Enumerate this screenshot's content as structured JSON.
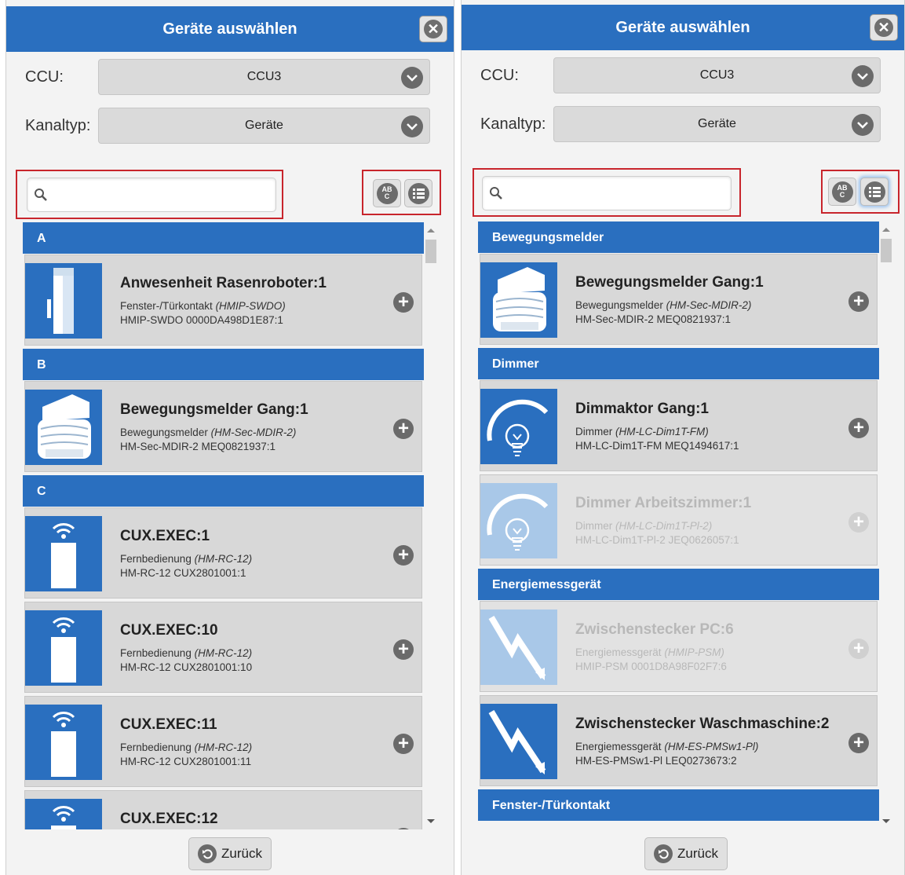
{
  "left": {
    "title": "Geräte auswählen",
    "ccu_label": "CCU:",
    "ccu_value": "CCU3",
    "kanaltyp_label": "Kanaltyp:",
    "kanaltyp_value": "Geräte",
    "search_placeholder": "",
    "sections": [
      {
        "header": "A",
        "items": [
          {
            "title": "Anwesenheit Rasenroboter:1",
            "type": "Fenster-/Türkontakt",
            "model": "(HMIP-SWDO)",
            "address": "HMIP-SWDO 0000DA498D1E87:1",
            "icon": "door-contact-icon"
          }
        ]
      },
      {
        "header": "B",
        "items": [
          {
            "title": "Bewegungsmelder Gang:1",
            "type": "Bewegungsmelder",
            "model": "(HM-Sec-MDIR-2)",
            "address": "HM-Sec-MDIR-2 MEQ0821937:1",
            "icon": "motion-sensor-icon"
          }
        ]
      },
      {
        "header": "C",
        "items": [
          {
            "title": "CUX.EXEC:1",
            "type": "Fernbedienung",
            "model": "(HM-RC-12)",
            "address": "HM-RC-12 CUX2801001:1",
            "icon": "remote-control-icon"
          },
          {
            "title": "CUX.EXEC:10",
            "type": "Fernbedienung",
            "model": "(HM-RC-12)",
            "address": "HM-RC-12 CUX2801001:10",
            "icon": "remote-control-icon"
          },
          {
            "title": "CUX.EXEC:11",
            "type": "Fernbedienung",
            "model": "(HM-RC-12)",
            "address": "HM-RC-12 CUX2801001:11",
            "icon": "remote-control-icon"
          },
          {
            "title": "CUX.EXEC:12",
            "type": "",
            "model": "",
            "address": "",
            "icon": "remote-control-icon"
          }
        ]
      }
    ],
    "back_label": "Zurück"
  },
  "right": {
    "title": "Geräte auswählen",
    "ccu_label": "CCU:",
    "ccu_value": "CCU3",
    "kanaltyp_label": "Kanaltyp:",
    "kanaltyp_value": "Geräte",
    "search_placeholder": "",
    "sections": [
      {
        "header": "Bewegungsmelder",
        "items": [
          {
            "title": "Bewegungsmelder Gang:1",
            "type": "Bewegungsmelder",
            "model": "(HM-Sec-MDIR-2)",
            "address": "HM-Sec-MDIR-2 MEQ0821937:1",
            "icon": "motion-sensor-icon",
            "disabled": false
          }
        ]
      },
      {
        "header": "Dimmer",
        "items": [
          {
            "title": "Dimmaktor Gang:1",
            "type": "Dimmer",
            "model": "(HM-LC-Dim1T-FM)",
            "address": "HM-LC-Dim1T-FM MEQ1494617:1",
            "icon": "dimmer-bulb-icon",
            "disabled": false
          },
          {
            "title": "Dimmer Arbeitszimmer:1",
            "type": "Dimmer",
            "model": "(HM-LC-Dim1T-Pl-2)",
            "address": "HM-LC-Dim1T-Pl-2 JEQ0626057:1",
            "icon": "dimmer-bulb-icon",
            "disabled": true
          }
        ]
      },
      {
        "header": "Energiemessgerät",
        "items": [
          {
            "title": "Zwischenstecker PC:6",
            "type": "Energiemessgerät",
            "model": "(HMIP-PSM)",
            "address": "HMIP-PSM 0001D8A98F02F7:6",
            "icon": "energy-meter-icon",
            "disabled": true
          },
          {
            "title": "Zwischenstecker Waschmaschine:2",
            "type": "Energiemessgerät",
            "model": "(HM-ES-PMSw1-Pl)",
            "address": "HM-ES-PMSw1-Pl LEQ0273673:2",
            "icon": "energy-meter-icon",
            "disabled": false
          }
        ]
      },
      {
        "header": "Fenster-/Türkontakt",
        "items": []
      }
    ],
    "back_label": "Zurück"
  },
  "colors": {
    "accent": "#2a6fbf",
    "highlight": "#c8252c"
  }
}
